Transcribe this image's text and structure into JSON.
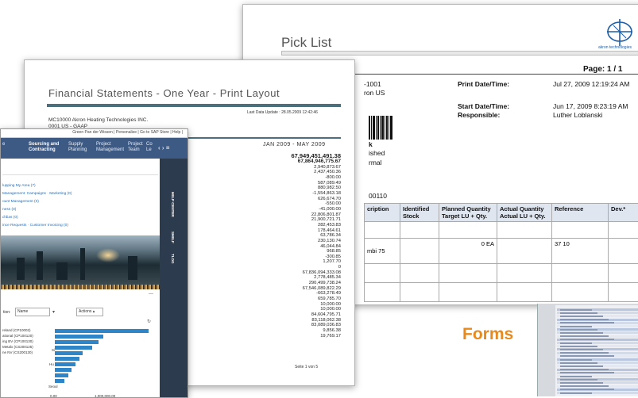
{
  "pick_list": {
    "title": "Pick List",
    "logo_text": "akron technologies",
    "page_label": "Page:",
    "page_value": "1 / 1",
    "fragments": {
      "id": "-1001",
      "location": "ron US",
      "k": "k",
      "status1": "ished",
      "status2": "rmal",
      "order": "00110"
    },
    "fields": [
      {
        "label": "Print Date/Time:",
        "value": "Jul 27, 2009 12:19:24 AM"
      },
      {
        "label": "Start Date/Time:",
        "value": "Jun 17, 2009 8:23:19 AM"
      },
      {
        "label": "Responsible:",
        "value": "Luther Loblanski"
      }
    ],
    "table": {
      "headers": [
        "cription",
        "Identified Stock",
        "Planned Quantity Target LU + Qty.",
        "Actual Quantity Actual LU + Qty.",
        "Reference",
        "Dev.*"
      ],
      "rows": [
        [
          "",
          "",
          "",
          "",
          "",
          ""
        ],
        [
          "mbi 75",
          "",
          "0 EA",
          "",
          "37 10",
          ""
        ],
        [
          "",
          "",
          "",
          "",
          "",
          ""
        ],
        [
          "",
          "",
          "",
          "",
          "",
          ""
        ]
      ]
    }
  },
  "financial": {
    "title": "Financial Statements - One Year - Print Layout",
    "last_update": "Last Data Update : 28.05.2009  12:42:46",
    "company": "MC10000 Akron Heating Technologies INC.",
    "company2": "0001 US - GAAP",
    "period": "JAN 2009 - MAY 2009",
    "values": [
      "67,949,451,491.38",
      "67,864,946,775.67",
      "2,940,873.67",
      "2,437,450.36",
      "-800.00",
      "587,089.49",
      "880,982.50",
      "-1,554,863.18",
      "626,674.70",
      "-550.00",
      "-41,000.00",
      "22,806,801.87",
      "21,900,721.71",
      "282,453.83",
      "178,464.61",
      "63,786.34",
      "230,130.74",
      "46,044.84",
      "968.85",
      "-300.85",
      "1,207.70",
      "0",
      "67,836,094,333.08",
      "2,778,485.34",
      "290,499,738.24",
      "67,546,089,822.29",
      "-663,278.49",
      "659,785.70",
      "10,000.00",
      "10,000.00",
      "84,604,795.71",
      "83,118,062.38",
      "83,089,036.83",
      "9,856.38",
      "19,769.17"
    ],
    "page": "Seite 1 von 5"
  },
  "app": {
    "top_links": "Green Pan der Wissen   |   Personalize   |   Go to SAP Store   |   Help   |",
    "nav": [
      {
        "label": "e",
        "active": false
      },
      {
        "label": "Sourcing and Contracting",
        "active": true
      },
      {
        "label": "Supply Planning",
        "active": false
      },
      {
        "label": "Project Management",
        "active": false
      },
      {
        "label": "Project Team",
        "active": false
      },
      {
        "label": "Co Le",
        "active": false
      }
    ],
    "nav_arrows": "‹ › ≡",
    "links": [
      "lupping My Area (7)",
      "Management: Campaigns · Marketing (0)",
      "ount Management (0)",
      "ness (0)",
      "d'dias (0)",
      "ince Requests · Customer Invoicing (0)"
    ],
    "side_tabs": [
      "HELP CENTER",
      "SHELF",
      "TLOG"
    ],
    "filter_label": "tion:",
    "filter_value": "Name",
    "actions_label": "Actions ▴",
    "bar_chart": [
      {
        "label": "reland (CP10002)",
        "value": 1.0
      },
      {
        "label": "ational (CP100120)",
        "value": 0.52
      },
      {
        "label": "ing BV (CP100130)",
        "value": 0.47
      },
      {
        "label": "Metalx (CS200125)",
        "value": 0.4
      },
      {
        "label": "ne NV (CS200130)",
        "value": 0.3
      },
      {
        "label": "",
        "value": 0.26
      },
      {
        "label": "",
        "value": 0.22
      },
      {
        "label": "",
        "value": 0.18
      },
      {
        "label": "",
        "value": 0.14
      },
      {
        "label": "",
        "value": 0.1
      }
    ],
    "small_labels": [
      "Si",
      "Hu",
      "Seoul"
    ],
    "axis_labels": [
      "0.00",
      "1,000,000.00"
    ]
  },
  "forms_label": "Forms"
}
